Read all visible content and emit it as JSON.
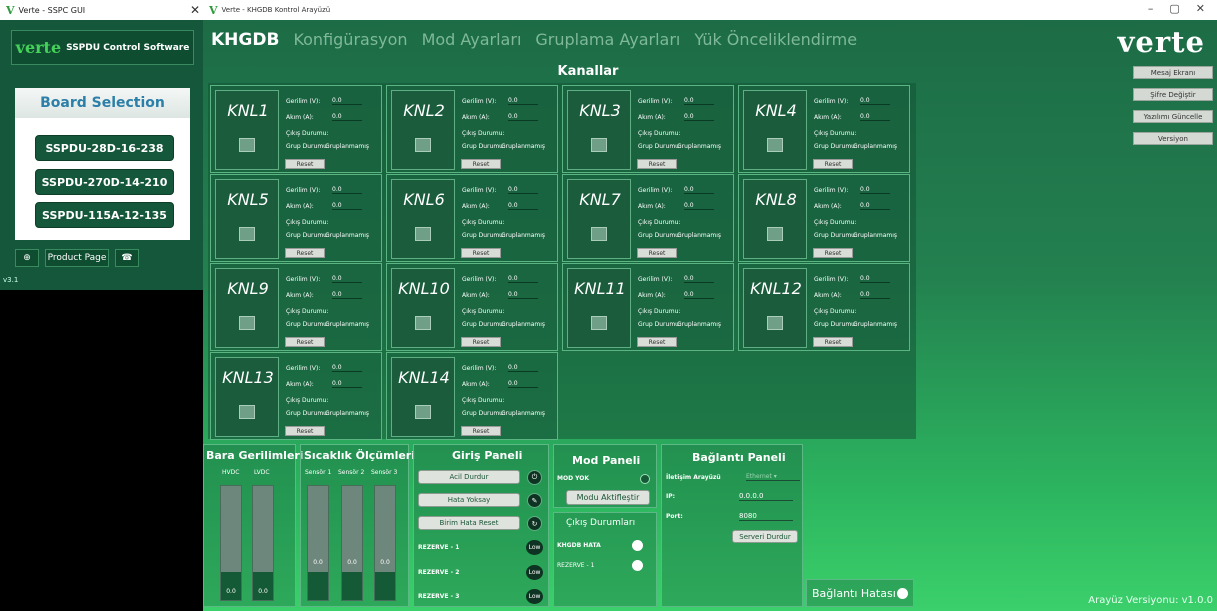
{
  "left_window": {
    "title": "Verte - SSPC GUI",
    "header": {
      "brand": "verte",
      "text": "SSPDU Control Software"
    },
    "board_selection": {
      "title": "Board Selection",
      "boards": [
        "SSPDU-28D-16-238",
        "SSPDU-270D-14-210",
        "SSPDU-115A-12-135"
      ]
    },
    "footer": {
      "product_page": "Product Page"
    },
    "version": "v3.1"
  },
  "right_window": {
    "title": "Verte - KHGDB Kontrol Arayüzü",
    "brand": "verte",
    "nav": [
      "KHGDB",
      "Konfigürasyon",
      "Mod Ayarları",
      "Gruplama Ayarları",
      "Yük Önceliklendirme"
    ],
    "channels_title": "Kanallar",
    "channel_labels": {
      "voltage": "Gerilim (V):",
      "current": "Akım (A):",
      "output": "Çıkış Durumu:",
      "group": "Grup Durumu:",
      "reset": "Reset"
    },
    "channels": [
      {
        "name": "KNL1",
        "voltage": "0.0",
        "current": "0.0",
        "group": "Gruplanmamış"
      },
      {
        "name": "KNL2",
        "voltage": "0.0",
        "current": "0.0",
        "group": "Gruplanmamış"
      },
      {
        "name": "KNL3",
        "voltage": "0.0",
        "current": "0.0",
        "group": "Gruplanmamış"
      },
      {
        "name": "KNL4",
        "voltage": "0.0",
        "current": "0.0",
        "group": "Gruplanmamış"
      },
      {
        "name": "KNL5",
        "voltage": "0.0",
        "current": "0.0",
        "group": "Gruplanmamış"
      },
      {
        "name": "KNL6",
        "voltage": "0.0",
        "current": "0.0",
        "group": "Gruplanmamış"
      },
      {
        "name": "KNL7",
        "voltage": "0.0",
        "current": "0.0",
        "group": "Gruplanmamış"
      },
      {
        "name": "KNL8",
        "voltage": "0.0",
        "current": "0.0",
        "group": "Gruplanmamış"
      },
      {
        "name": "KNL9",
        "voltage": "0.0",
        "current": "0.0",
        "group": "Gruplanmamış"
      },
      {
        "name": "KNL10",
        "voltage": "0.0",
        "current": "0.0",
        "group": "Gruplanmamış"
      },
      {
        "name": "KNL11",
        "voltage": "0.0",
        "current": "0.0",
        "group": "Gruplanmamış"
      },
      {
        "name": "KNL12",
        "voltage": "0.0",
        "current": "0.0",
        "group": "Gruplanmamış"
      },
      {
        "name": "KNL13",
        "voltage": "0.0",
        "current": "0.0",
        "group": "Gruplanmamış"
      },
      {
        "name": "KNL14",
        "voltage": "0.0",
        "current": "0.0",
        "group": "Gruplanmamış"
      }
    ],
    "side_buttons": [
      "Mesaj Ekranı",
      "Şifre Değiştir",
      "Yazılımı Güncelle",
      "Versiyon"
    ],
    "bara": {
      "title": "Bara Gerilimleri",
      "bars": [
        {
          "label": "HVDC",
          "value": "0.0"
        },
        {
          "label": "LVDC",
          "value": "0.0"
        }
      ]
    },
    "sicaklik": {
      "title": "Sıcaklık Ölçümleri",
      "sensors": [
        {
          "label": "Sensör 1",
          "value": "0.0"
        },
        {
          "label": "Sensör 2",
          "value": "0.0"
        },
        {
          "label": "Sensör 3",
          "value": "0.0"
        }
      ]
    },
    "giris": {
      "title": "Giriş Paneli",
      "buttons": [
        "Acil Durdur",
        "Hata Yoksay",
        "Birim Hata Reset"
      ],
      "reserves": [
        {
          "label": "REZERVE - 1",
          "state": "Low"
        },
        {
          "label": "REZERVE - 2",
          "state": "Low"
        },
        {
          "label": "REZERVE - 3",
          "state": "Low"
        }
      ]
    },
    "mod": {
      "title": "Mod Paneli",
      "mode_value": "MOD YOK",
      "activate": "Modu Aktifleştir",
      "outputs_title": "Çıkış Durumları",
      "outputs": [
        "KHGDB HATA",
        "REZERVE - 1"
      ]
    },
    "baglanti": {
      "title": "Bağlantı Paneli",
      "interface_label": "İletişim Arayüzü",
      "interface_value": "Ethernet",
      "ip_label": "IP:",
      "ip_value": "0.0.0.0",
      "port_label": "Port:",
      "port_value": "8080",
      "stop_server": "Serveri Durdur"
    },
    "connection_error": "Bağlantı Hatası",
    "interface_version": "Arayüz Versiyonu: v1.0.0"
  }
}
